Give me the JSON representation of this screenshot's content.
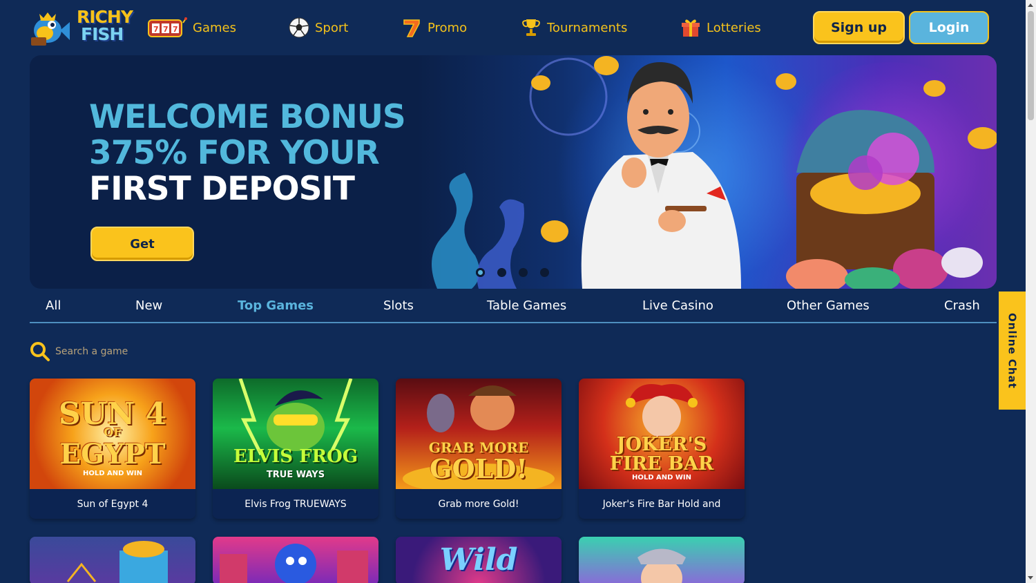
{
  "brand": {
    "line1": "RICHY",
    "line2": "FISH"
  },
  "nav": [
    {
      "label": "Games",
      "icon": "slot-machine-icon"
    },
    {
      "label": "Sport",
      "icon": "soccer-ball-icon"
    },
    {
      "label": "Promo",
      "icon": "lucky-seven-icon"
    },
    {
      "label": "Tournaments",
      "icon": "trophy-icon"
    },
    {
      "label": "Lotteries",
      "icon": "gift-icon"
    }
  ],
  "auth": {
    "signup": "Sign up",
    "login": "Login"
  },
  "banner": {
    "line1": "WELCOME BONUS",
    "line2": "375% FOR YOUR",
    "line3": "FIRST DEPOSIT",
    "cta": "Get",
    "slides": 4,
    "active_slide": 1
  },
  "categories": [
    {
      "label": "All",
      "active": false
    },
    {
      "label": "New",
      "active": false
    },
    {
      "label": "Top Games",
      "active": true
    },
    {
      "label": "Slots",
      "active": false
    },
    {
      "label": "Table Games",
      "active": false
    },
    {
      "label": "Live Casino",
      "active": false
    },
    {
      "label": "Other Games",
      "active": false
    },
    {
      "label": "Crash",
      "active": false
    }
  ],
  "search": {
    "placeholder": "Search a game",
    "value": ""
  },
  "games": [
    {
      "title": "Sun of Egypt 4",
      "art": [
        "SUN 4",
        "OF",
        "EGYPT",
        "HOLD AND WIN"
      ]
    },
    {
      "title": "Elvis Frog TRUEWAYS",
      "art": [
        "ELVIS FROG",
        "TRUE WAYS"
      ]
    },
    {
      "title": "Grab more Gold!",
      "art": [
        "GRAB MORE",
        "GOLD!"
      ]
    },
    {
      "title": "Joker's Fire Bar Hold and",
      "art": [
        "JOKER'S",
        "FIRE BAR",
        "HOLD AND WIN"
      ]
    }
  ],
  "games_row2": [
    {
      "art": ""
    },
    {
      "art": ""
    },
    {
      "art": "Wild"
    },
    {
      "art": ""
    }
  ],
  "chat": {
    "label": "Online Chat"
  },
  "colors": {
    "background": "#0f2a57",
    "accent_yellow": "#fac31c",
    "accent_blue": "#5ab4dd"
  }
}
